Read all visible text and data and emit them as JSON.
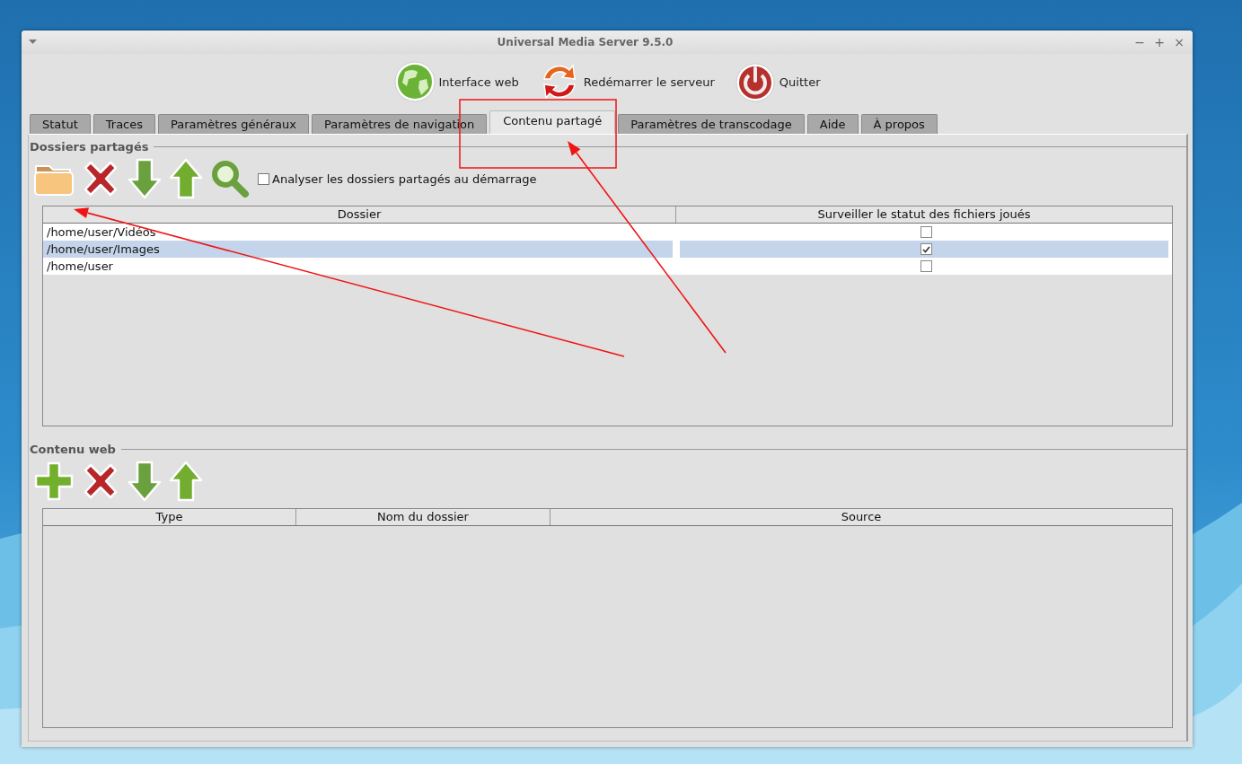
{
  "window": {
    "title": "Universal Media Server 9.5.0",
    "controls": [
      "−",
      "+",
      "×"
    ]
  },
  "toolbar": [
    {
      "label": "Interface web",
      "kind": "globe"
    },
    {
      "label": "Redémarrer le serveur",
      "kind": "restart"
    },
    {
      "label": "Quitter",
      "kind": "power"
    }
  ],
  "tabs": [
    {
      "label": "Statut",
      "selected": false
    },
    {
      "label": "Traces",
      "selected": false
    },
    {
      "label": "Paramètres généraux",
      "selected": false
    },
    {
      "label": "Paramètres de navigation",
      "selected": false
    },
    {
      "label": "Contenu partagé",
      "selected": true
    },
    {
      "label": "Paramètres de transcodage",
      "selected": false
    },
    {
      "label": "Aide",
      "selected": false
    },
    {
      "label": "À propos",
      "selected": false
    }
  ],
  "shared_folders": {
    "title": "Dossiers partagés",
    "tools": [
      {
        "kind": "folder"
      },
      {
        "kind": "remove"
      },
      {
        "kind": "down"
      },
      {
        "kind": "up"
      },
      {
        "kind": "search"
      }
    ],
    "scan_checkbox": {
      "label": "Analyser les dossiers partagés au démarrage",
      "checked": false
    },
    "table": {
      "columns": [
        "Dossier",
        "Surveiller le statut des fichiers joués"
      ],
      "rows": [
        {
          "folder": "/home/user/Vidéos",
          "monitor": false,
          "selected": false
        },
        {
          "folder": "/home/user/Images",
          "monitor": true,
          "selected": true
        },
        {
          "folder": "/home/user",
          "monitor": false,
          "selected": false
        }
      ]
    }
  },
  "web_content": {
    "title": "Contenu web",
    "tools": [
      {
        "kind": "add"
      },
      {
        "kind": "remove"
      },
      {
        "kind": "down"
      },
      {
        "kind": "up"
      }
    ],
    "table": {
      "columns": [
        "Type",
        "Nom du dossier",
        "Source"
      ]
    }
  },
  "annotations": [
    {
      "kind": "box"
    },
    {
      "kind": "arrow"
    },
    {
      "kind": "arrow"
    }
  ]
}
